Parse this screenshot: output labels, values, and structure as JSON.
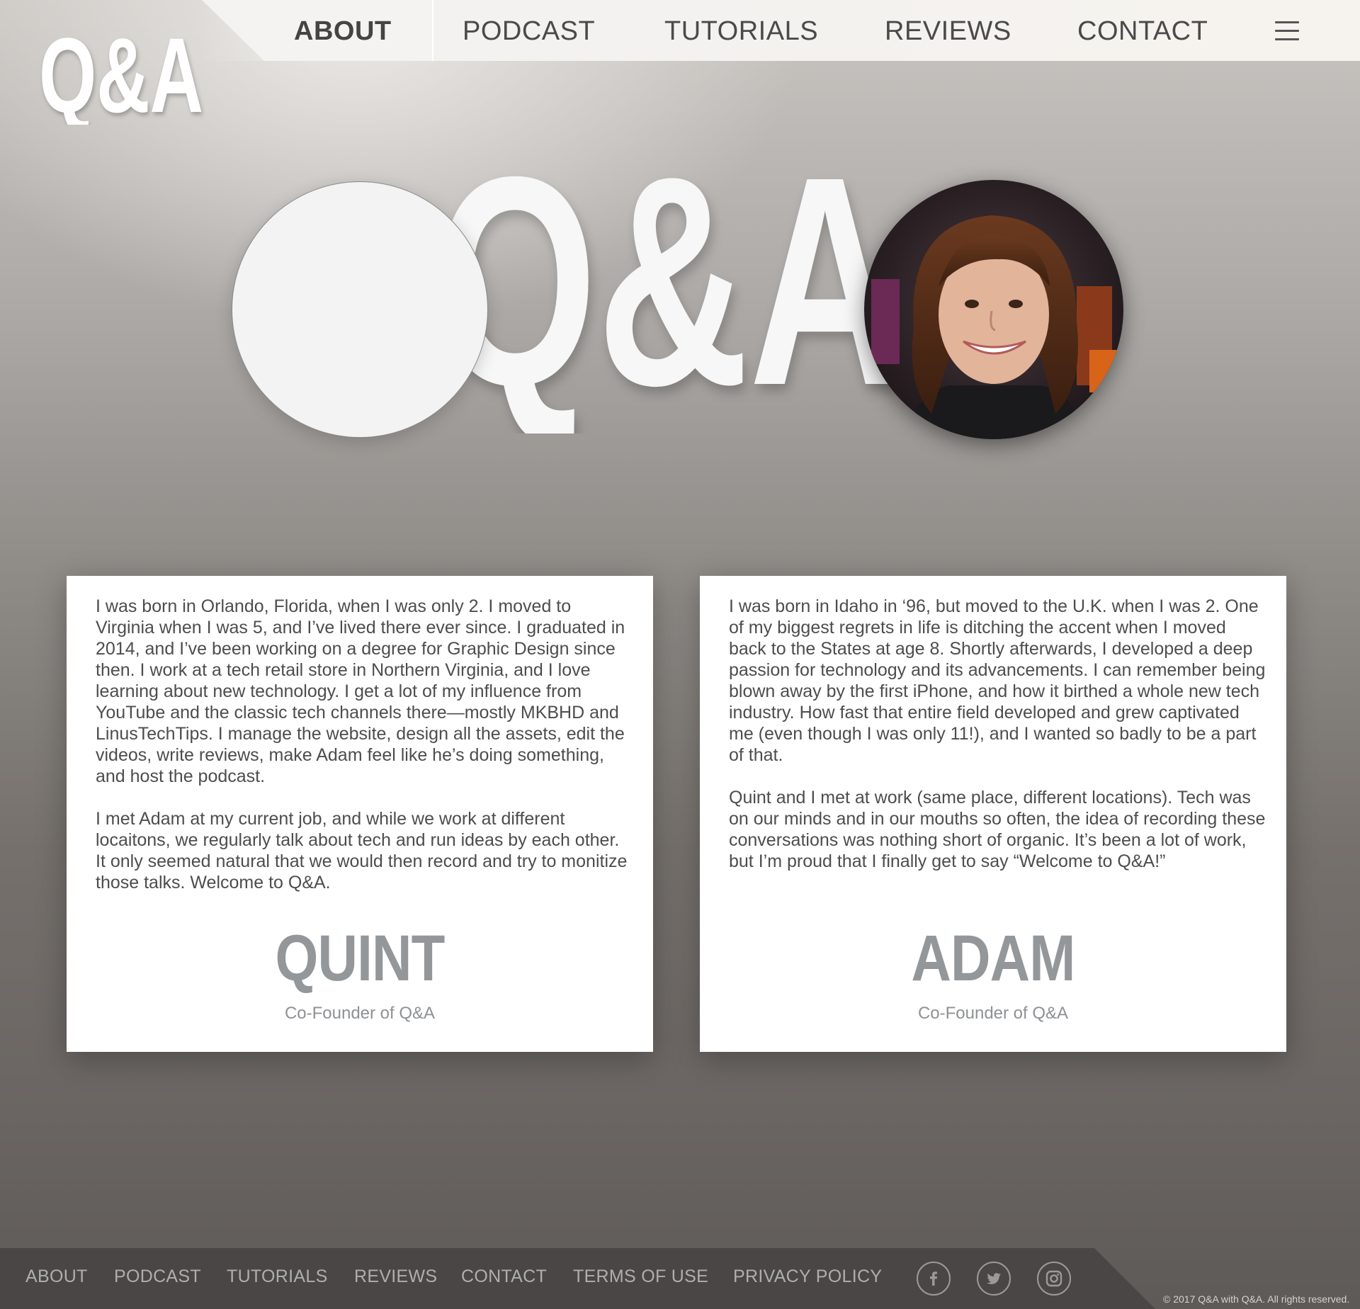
{
  "brand": {
    "logo_text": "Q&A"
  },
  "nav": {
    "items": [
      "ABOUT",
      "PODCAST",
      "TUTORIALS",
      "REVIEWS",
      "CONTACT"
    ],
    "active": "ABOUT",
    "menu_icon": "hamburger-menu-icon"
  },
  "hero": {
    "logo_text": "Q&A",
    "left_avatar": "placeholder",
    "right_avatar": "adam-portrait"
  },
  "cards": [
    {
      "paragraphs": [
        "I was born in Orlando, Florida, when I was only 2. I moved to Virginia when I was 5, and I’ve lived there ever since. I graduated in 2014, and I’ve been working on a degree for Graphic Design since then. I work at a tech retail store in Northern Virginia, and I love learning about new technology. I get a lot of my influence from YouTube and the classic tech channels there—mostly MKBHD and LinusTechTips. I manage the website, design all the assets, edit the videos, write reviews, make Adam feel like he’s doing something, and host the podcast.",
        "I met Adam at my current job, and while we work at different locaitons, we regularly talk about tech and run ideas by each other. It only seemed natural that we would then record and try to monitize those talks. Welcome to Q&A."
      ],
      "name": "QUINT",
      "role": "Co-Founder of Q&A"
    },
    {
      "paragraphs": [
        "I was born in Idaho in ‘96, but moved to the U.K. when I was 2. One of my biggest regrets in life is ditching the accent when I moved back to the States at age 8.  Shortly afterwards, I developed a deep passion for technology and its advancements.  I can remember being blown away by the first iPhone, and how it birthed a whole new tech industry. How fast that entire field developed and grew captivated me (even though I was only 11!), and I wanted so badly to be a part of that.",
        "Quint and I met at work (same place, different locations). Tech was on our minds and in our mouths so often, the idea of recording these conversations was nothing short of organic.  It’s been a lot of work, but I’m proud that I finally get to say “Welcome to Q&A!”"
      ],
      "name": "ADAM",
      "role": "Co-Founder of Q&A"
    }
  ],
  "footer": {
    "links": [
      "ABOUT",
      "PODCAST",
      "TUTORIALS",
      "REVIEWS",
      "CONTACT",
      "TERMS OF USE",
      "PRIVACY POLICY"
    ],
    "social": [
      "facebook-icon",
      "twitter-icon",
      "instagram-icon"
    ],
    "copyright": "© 2017 Q&A with Q&A. All rights reserved."
  },
  "colors": {
    "nav_text": "#4a4a4a",
    "card_name": "#94979a",
    "footer_bg": "#4a4646",
    "footer_text": "#aeaeae"
  }
}
